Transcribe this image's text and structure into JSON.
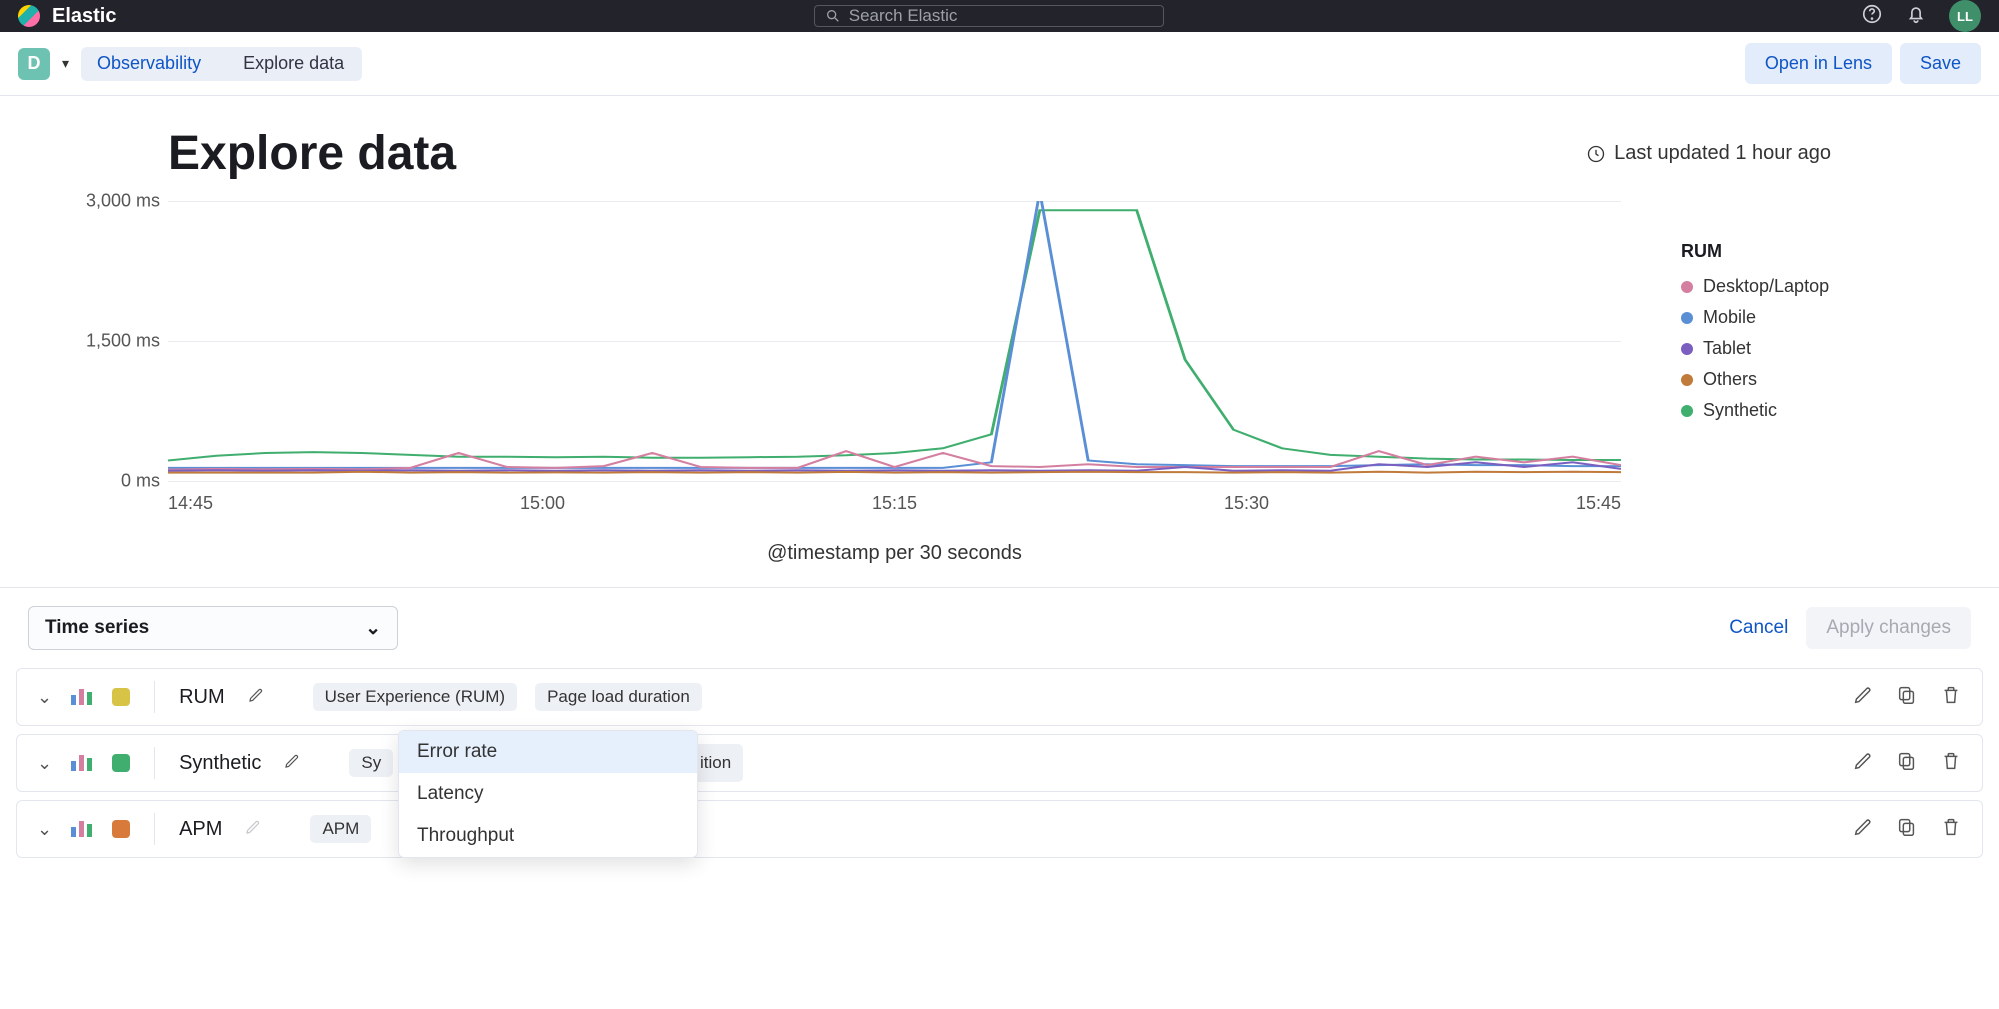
{
  "topbar": {
    "brand": "Elastic",
    "search_placeholder": "Search Elastic",
    "avatar_initials": "LL"
  },
  "subbar": {
    "space_letter": "D",
    "crumb1": "Observability",
    "crumb2": "Explore data",
    "open_lens": "Open in Lens",
    "save": "Save"
  },
  "title": "Explore data",
  "updated": "Last updated 1 hour ago",
  "legend": {
    "title": "RUM",
    "items": [
      {
        "label": "Desktop/Laptop",
        "color": "#d57fa0"
      },
      {
        "label": "Mobile",
        "color": "#5a8fd6"
      },
      {
        "label": "Tablet",
        "color": "#7b5fc0"
      },
      {
        "label": "Others",
        "color": "#c07a3a"
      },
      {
        "label": "Synthetic",
        "color": "#3fae6e"
      }
    ]
  },
  "chart_data": {
    "type": "line",
    "xlabel": "@timestamp per 30 seconds",
    "ylabel": "",
    "ylim": [
      0,
      3000
    ],
    "y_ticks": [
      "3,000 ms",
      "1,500 ms",
      "0 ms"
    ],
    "x_ticks": [
      "14:45",
      "15:00",
      "15:15",
      "15:30",
      "15:45"
    ],
    "x": [
      0,
      2,
      4,
      6,
      8,
      10,
      12,
      14,
      16,
      18,
      20,
      22,
      24,
      26,
      28,
      30,
      32,
      34,
      36,
      38,
      40,
      42,
      44,
      46,
      48,
      50,
      52,
      54,
      56,
      58,
      60
    ],
    "series": [
      {
        "name": "Synthetic",
        "color": "#3fae6e",
        "values": [
          220,
          270,
          300,
          310,
          300,
          280,
          260,
          260,
          255,
          260,
          250,
          250,
          255,
          260,
          275,
          300,
          350,
          500,
          2900,
          2900,
          2900,
          1300,
          550,
          350,
          280,
          260,
          240,
          230,
          230,
          225,
          225
        ]
      },
      {
        "name": "Mobile",
        "color": "#5a8fd6",
        "values": [
          140,
          140,
          140,
          140,
          140,
          140,
          140,
          140,
          140,
          140,
          140,
          140,
          140,
          140,
          140,
          140,
          140,
          200,
          3100,
          220,
          180,
          170,
          160,
          160,
          160,
          170,
          180,
          170,
          170,
          160,
          160
        ]
      },
      {
        "name": "Desktop/Laptop",
        "color": "#d57fa0",
        "values": [
          120,
          130,
          125,
          130,
          125,
          140,
          300,
          150,
          140,
          160,
          300,
          150,
          140,
          140,
          320,
          150,
          300,
          160,
          150,
          180,
          150,
          150,
          150,
          150,
          150,
          320,
          170,
          260,
          200,
          260,
          170
        ]
      },
      {
        "name": "Tablet",
        "color": "#7b5fc0",
        "values": [
          110,
          115,
          110,
          115,
          110,
          115,
          110,
          115,
          110,
          115,
          110,
          115,
          110,
          115,
          110,
          115,
          110,
          115,
          110,
          115,
          110,
          150,
          110,
          115,
          110,
          180,
          150,
          200,
          150,
          200,
          130
        ]
      },
      {
        "name": "Others",
        "color": "#c07a3a",
        "values": [
          90,
          90,
          90,
          90,
          100,
          90,
          95,
          90,
          92,
          90,
          95,
          90,
          95,
          90,
          98,
          90,
          95,
          90,
          95,
          100,
          95,
          95,
          90,
          95,
          90,
          100,
          90,
          100,
          95,
          100,
          95
        ]
      }
    ]
  },
  "controls": {
    "select_label": "Time series",
    "cancel": "Cancel",
    "apply": "Apply changes"
  },
  "rows": [
    {
      "name": "RUM",
      "swatch": "#d7c447",
      "pills": [
        "User Experience (RUM)",
        "Page load duration"
      ]
    },
    {
      "name": "Synthetic",
      "swatch": "#3fae6e",
      "pills": [
        "Sy"
      ],
      "truncated_suffix": "ition"
    },
    {
      "name": "APM",
      "swatch": "#d77a3a",
      "pills": [
        "APM"
      ],
      "disabled_pencil": true
    }
  ],
  "dropdown": {
    "items": [
      "Error rate",
      "Latency",
      "Throughput"
    ],
    "selected_index": 0
  }
}
